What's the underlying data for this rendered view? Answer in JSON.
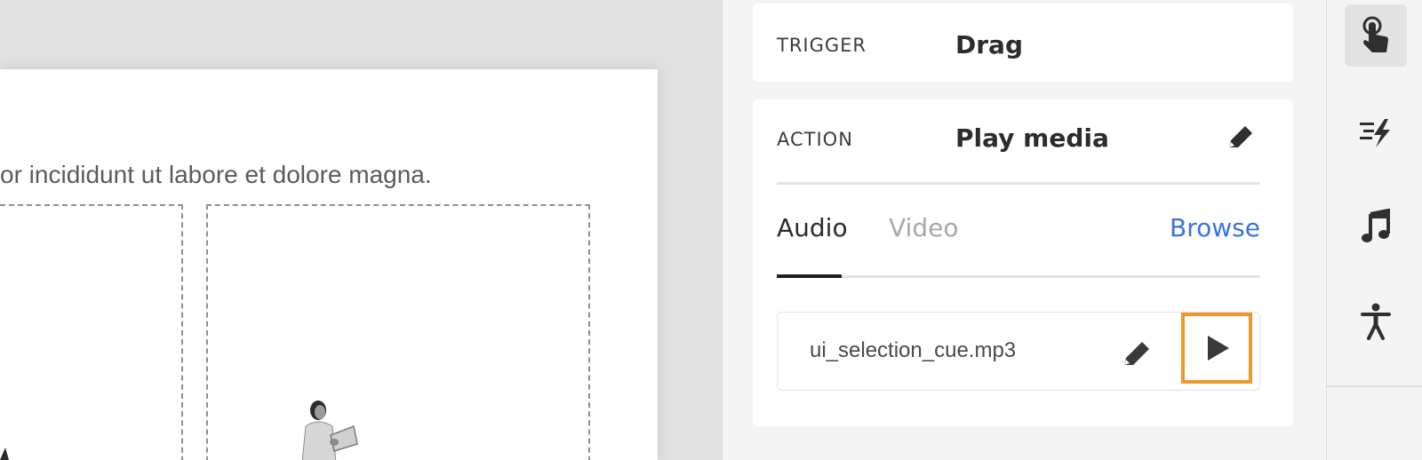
{
  "canvas": {
    "body_text": "or incididunt ut labore et dolore magna."
  },
  "trigger": {
    "label": "TRIGGER",
    "value": "Drag"
  },
  "action": {
    "label": "ACTION",
    "value": "Play media",
    "tabs": [
      {
        "label": "Audio",
        "selected": true
      },
      {
        "label": "Video",
        "selected": false
      }
    ],
    "browse_label": "Browse",
    "file_name": "ui_selection_cue.mp3"
  },
  "rail": {
    "items": [
      {
        "icon": "touch-gesture-icon",
        "active": true
      },
      {
        "icon": "animation-bolt-icon",
        "active": false
      },
      {
        "icon": "music-note-icon",
        "active": false
      },
      {
        "icon": "accessibility-icon",
        "active": false
      }
    ]
  },
  "colors": {
    "accent_link": "#3a73d8",
    "highlight_border": "#f0972b",
    "panel_bg": "#f4f4f4",
    "canvas_bg": "#e1e1e1"
  }
}
